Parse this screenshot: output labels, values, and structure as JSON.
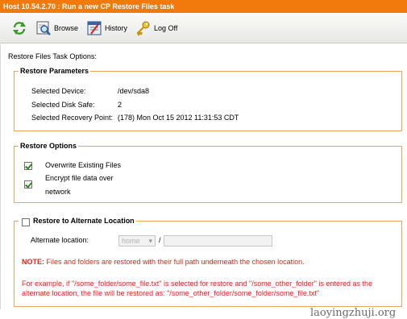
{
  "window": {
    "title": "Host 10.54.2.70 : Run a new CP Restore Files task"
  },
  "toolbar": {
    "items": [
      {
        "icon": "refresh-icon",
        "label": ""
      },
      {
        "icon": "browse-icon",
        "label": "Browse"
      },
      {
        "icon": "history-icon",
        "label": "History"
      },
      {
        "icon": "logoff-key-icon",
        "label": "Log Off"
      }
    ]
  },
  "main": {
    "heading": "Restore Files Task Options:",
    "restore_parameters": {
      "legend": "Restore Parameters",
      "device_label": "Selected Device:",
      "device_value": "/dev/sda8",
      "disk_safe_label": "Selected Disk Safe:",
      "disk_safe_value": "2",
      "recovery_point_label": "Selected Recovery Point:",
      "recovery_point_value": "(178) Mon Oct 15 2012 11:31:53 CDT"
    },
    "restore_options": {
      "legend": "Restore Options",
      "overwrite_label": "Overwrite Existing Files",
      "overwrite_checked": true,
      "encrypt_label_line1": "Encrypt file data over",
      "encrypt_label_line2": "network",
      "encrypt_checked": true
    },
    "alternate_location": {
      "legend": "Restore to Alternate Location",
      "checked": false,
      "location_label": "Alternate location:",
      "select_value": "home",
      "separator": "/",
      "path_value": "",
      "note_label": "NOTE:",
      "note_text": " Files and folders are restored with their full path underneath the chosen location.",
      "example_line1": "For example, if \"/some_folder/some_file.txt\" is selected for restore and \"/some_other_folder\" is entered as the",
      "example_line2": "alternate location, the file will be restored as: \"/some_other_folder/some_folder/some_file.txt\""
    }
  },
  "watermark": "laoyingzhuji.org",
  "colors": {
    "title_bar": "#f27a0c",
    "group_border": "#f0a45a",
    "note_red": "#e8211b"
  }
}
